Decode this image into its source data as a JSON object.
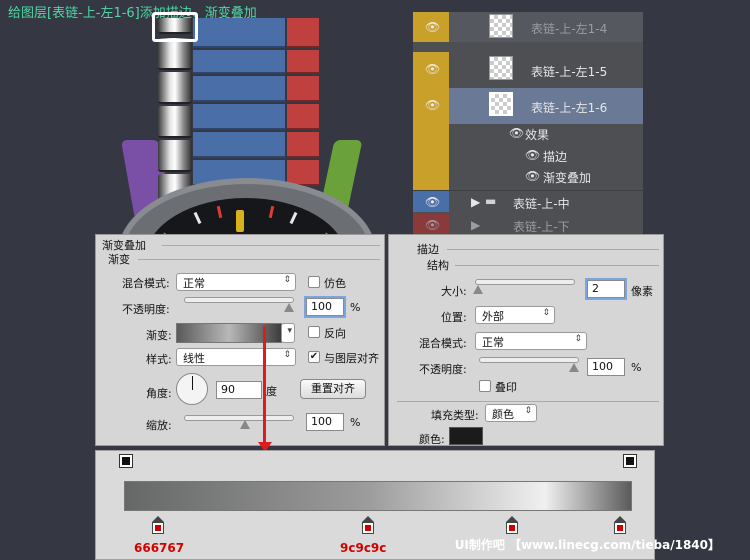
{
  "caption": "给图层[表链-上-左1-6]添加描边、渐变叠加",
  "layers": {
    "rows": [
      {
        "name": "表链-上-左1-4"
      },
      {
        "name": "表链-上-左1-5"
      },
      {
        "name": "表链-上-左1-6"
      }
    ],
    "effects_label": "效果",
    "effect_items": [
      "描边",
      "渐变叠加"
    ],
    "group1": "表链-上-中",
    "group2": "表链-上-下"
  },
  "gradient_overlay": {
    "title": "渐变叠加",
    "section": "渐变",
    "blend_mode_label": "混合模式:",
    "blend_mode": "正常",
    "dither_label": "仿色",
    "opacity_label": "不透明度:",
    "opacity": "100",
    "percent": "%",
    "gradient_label": "渐变:",
    "reverse_label": "反向",
    "style_label": "样式:",
    "style": "线性",
    "align_label": "与图层对齐",
    "angle_label": "角度:",
    "angle": "90",
    "degree": "度",
    "reset_button": "重置对齐",
    "scale_label": "缩放:",
    "scale": "100"
  },
  "stroke": {
    "title": "描边",
    "section": "结构",
    "size_label": "大小:",
    "size": "2",
    "size_unit": "像素",
    "position_label": "位置:",
    "position": "外部",
    "blend_mode_label": "混合模式:",
    "blend_mode": "正常",
    "opacity_label": "不透明度:",
    "opacity": "100",
    "percent": "%",
    "overprint_label": "叠印",
    "fill_type_label": "填充类型:",
    "fill_type": "颜色",
    "color_label": "颜色:",
    "color": "#1b1b1b"
  },
  "gradient_stops": {
    "colors": [
      "666767",
      "9c9c9c",
      "f0f0f0",
      "5c5b5b"
    ],
    "labels": [
      "666767",
      "9c9c9c",
      "",
      ""
    ]
  },
  "footer": "UI制作吧 【www.linecg.com/tieba/1840】"
}
